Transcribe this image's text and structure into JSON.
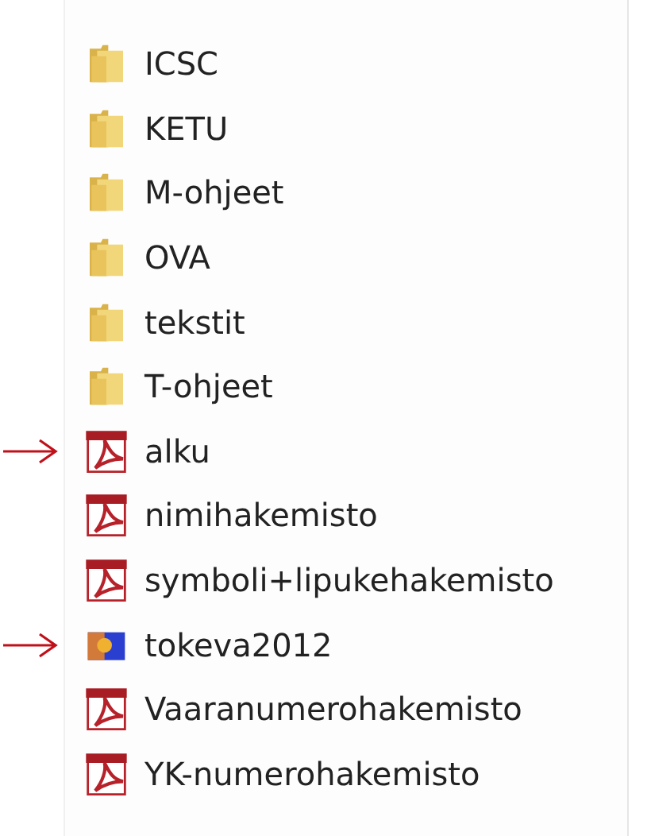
{
  "files": [
    {
      "name": "ICSC",
      "kind": "folder",
      "marked": false
    },
    {
      "name": "KETU",
      "kind": "folder",
      "marked": false
    },
    {
      "name": "M-ohjeet",
      "kind": "folder",
      "marked": false
    },
    {
      "name": "OVA",
      "kind": "folder",
      "marked": false
    },
    {
      "name": "tekstit",
      "kind": "folder",
      "marked": false
    },
    {
      "name": "T-ohjeet",
      "kind": "folder",
      "marked": false
    },
    {
      "name": "alku",
      "kind": "pdf",
      "marked": true
    },
    {
      "name": "nimihakemisto",
      "kind": "pdf",
      "marked": false
    },
    {
      "name": "symboli+lipukehakemisto",
      "kind": "pdf",
      "marked": false
    },
    {
      "name": "tokeva2012",
      "kind": "app",
      "marked": true
    },
    {
      "name": "Vaaranumerohakemisto",
      "kind": "pdf",
      "marked": false
    },
    {
      "name": "YK-numerohakemisto",
      "kind": "pdf",
      "marked": false
    }
  ]
}
